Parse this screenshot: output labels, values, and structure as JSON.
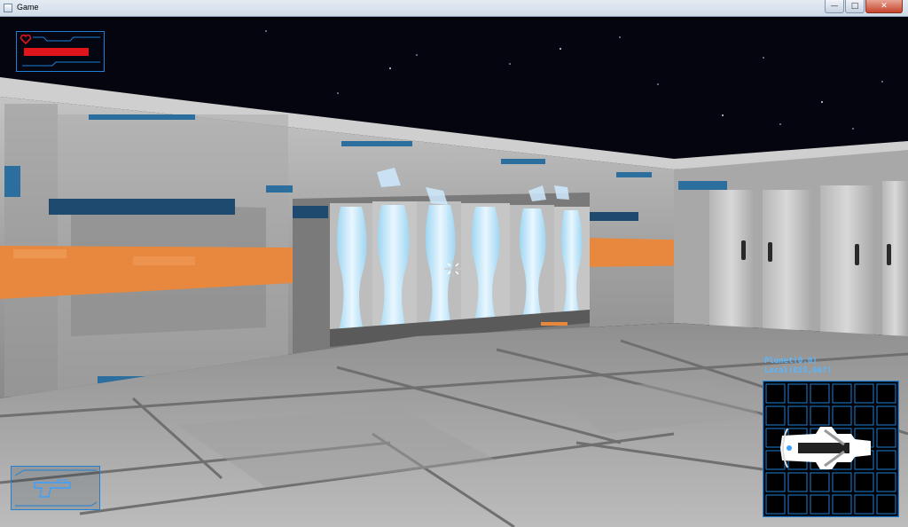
{
  "window": {
    "title": "Game",
    "minimize_glyph": "—",
    "maximize_glyph": "□",
    "close_glyph": "✕"
  },
  "hud": {
    "health": {
      "level": 0.85,
      "bar_color": "#e0141b",
      "icon": "heart-icon"
    },
    "weapon": {
      "icon": "pistol-icon"
    },
    "planet_coords": "Planet(0,0)",
    "local_coords": "Local(025,067)",
    "accent_color": "#1d7fd6"
  }
}
